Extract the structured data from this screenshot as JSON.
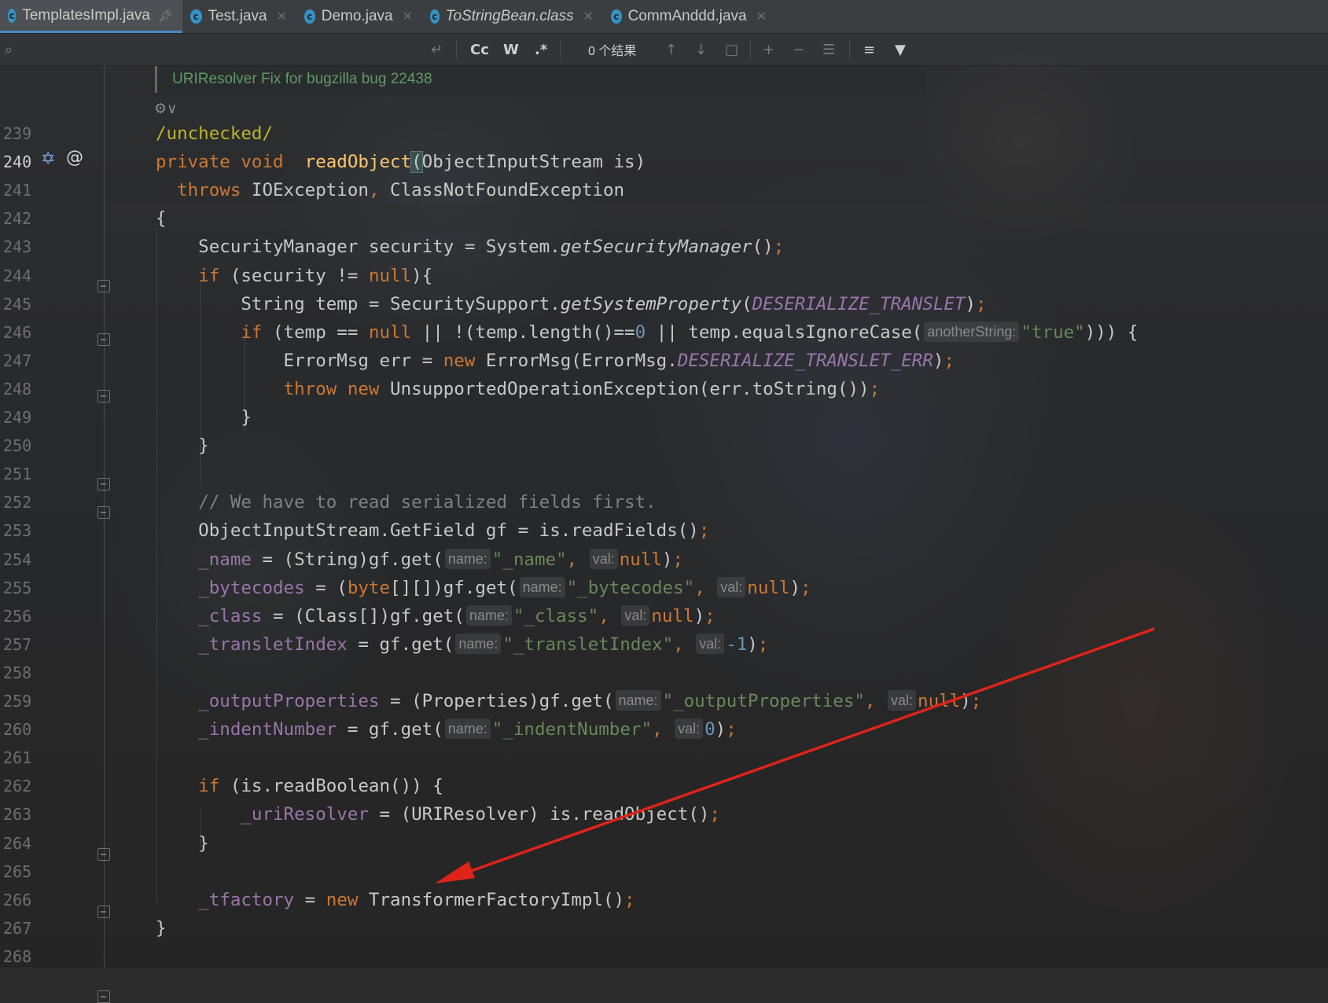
{
  "tabs": [
    {
      "label": "TemplatesImpl.java",
      "active": true,
      "pinned": true
    },
    {
      "label": "Test.java",
      "active": false
    },
    {
      "label": "Demo.java",
      "active": false
    },
    {
      "label": "ToStringBean.class",
      "active": false,
      "italic": true
    },
    {
      "label": "CommAnddd.java",
      "active": false
    }
  ],
  "find": {
    "search_icon": "search-icon",
    "result_count": "0 个结果",
    "match_case": "Cc",
    "words": "W",
    "regex": ".*"
  },
  "doc_comment": "URIResolver Fix for bugzilla bug 22438",
  "lines": [
    {
      "n": "239",
      "html": "<span class=\"ann\">/unchecked/</span>"
    },
    {
      "n": "240",
      "html": "<span class=\"kw\">private void</span>  <span class=\"fn\">readObject</span><span class=\"parenhl\">(</span>ObjectInputStream is)"
    },
    {
      "n": "241",
      "html": "  <span class=\"kw\">throws</span> IOException<span class=\"kw\">,</span> ClassNotFoundException"
    },
    {
      "n": "242",
      "html": "{"
    },
    {
      "n": "243",
      "html": "    SecurityManager security = System.<span class=\"it\">getSecurityManager</span>()<span class=\"kw\">;</span>"
    },
    {
      "n": "244",
      "html": "    <span class=\"kw\">if</span> (security != <span class=\"kw\">null</span>){"
    },
    {
      "n": "245",
      "html": "        String temp = SecuritySupport.<span class=\"it\">getSystemProperty</span>(<span class=\"sf\">DESERIALIZE_TRANSLET</span>)<span class=\"kw\">;</span>"
    },
    {
      "n": "246",
      "html": "        <span class=\"kw\">if</span> (temp == <span class=\"kw\">null</span> || !(temp.length()==<span class=\"num\">0</span> || temp.equalsIgnoreCase(<span class=\"hint\">anotherString:</span><span class=\"str\">\"true\"</span>))) {"
    },
    {
      "n": "247",
      "html": "            ErrorMsg err = <span class=\"kw\">new</span> ErrorMsg(ErrorMsg.<span class=\"sf\">DESERIALIZE_TRANSLET_ERR</span>)<span class=\"kw\">;</span>"
    },
    {
      "n": "248",
      "html": "            <span class=\"kw\">throw new</span> UnsupportedOperationException(err.toString())<span class=\"kw\">;</span>"
    },
    {
      "n": "249",
      "html": "        }"
    },
    {
      "n": "250",
      "html": "    }"
    },
    {
      "n": "251",
      "html": ""
    },
    {
      "n": "252",
      "html": "    <span class=\"cm\">// We have to read serialized fields first.</span>"
    },
    {
      "n": "253",
      "html": "    ObjectInputStream.GetField gf = is.readFields()<span class=\"kw\">;</span>"
    },
    {
      "n": "254",
      "html": "    <span class=\"fld\">_name</span> = (String)gf.get(<span class=\"hint\">name:</span><span class=\"str\">\"_name\"</span><span class=\"kw\">,</span> <span class=\"hint\">val:</span><span class=\"kw\">null</span>)<span class=\"kw\">;</span>"
    },
    {
      "n": "255",
      "html": "    <span class=\"fld\">_bytecodes</span> = (<span class=\"kw\">byte</span>[][])gf.get(<span class=\"hint\">name:</span><span class=\"str\">\"_bytecodes\"</span><span class=\"kw\">,</span> <span class=\"hint\">val:</span><span class=\"kw\">null</span>)<span class=\"kw\">;</span>"
    },
    {
      "n": "256",
      "html": "    <span class=\"fld\">_class</span> = (Class[])gf.get(<span class=\"hint\">name:</span><span class=\"str\">\"_class\"</span><span class=\"kw\">,</span> <span class=\"hint\">val:</span><span class=\"kw\">null</span>)<span class=\"kw\">;</span>"
    },
    {
      "n": "257",
      "html": "    <span class=\"fld\">_transletIndex</span> = gf.get(<span class=\"hint\">name:</span><span class=\"str\">\"_transletIndex\"</span><span class=\"kw\">,</span> <span class=\"hint\">val:</span><span class=\"num\">-1</span>)<span class=\"kw\">;</span>"
    },
    {
      "n": "258",
      "html": ""
    },
    {
      "n": "259",
      "html": "    <span class=\"fld\">_outputProperties</span> = (Properties)gf.get(<span class=\"hint\">name:</span><span class=\"str\">\"_outputProperties\"</span><span class=\"kw\">,</span> <span class=\"hint\">val:</span><span class=\"kw\">null</span>)<span class=\"kw\">;</span>"
    },
    {
      "n": "260",
      "html": "    <span class=\"fld\">_indentNumber</span> = gf.get(<span class=\"hint\">name:</span><span class=\"str\">\"_indentNumber\"</span><span class=\"kw\">,</span> <span class=\"hint\">val:</span><span class=\"num\">0</span>)<span class=\"kw\">;</span>"
    },
    {
      "n": "261",
      "html": ""
    },
    {
      "n": "262",
      "html": "    <span class=\"kw\">if</span> (is.readBoolean()) {"
    },
    {
      "n": "263",
      "html": "        <span class=\"fld\">_uriResolver</span> = (URIResolver) is.readObject()<span class=\"kw\">;</span>"
    },
    {
      "n": "264",
      "html": "    }"
    },
    {
      "n": "265",
      "html": ""
    },
    {
      "n": "266",
      "html": "    <span class=\"fld\">_tfactory</span> = <span class=\"kw\">new</span> TransformerFactoryImpl()<span class=\"kw\">;</span>"
    },
    {
      "n": "267",
      "html": "}"
    },
    {
      "n": "268",
      "html": ""
    }
  ],
  "gutter_icons": {
    "line_240": [
      "override-icon",
      "annotation-at-icon"
    ],
    "at_symbol": "@"
  },
  "colors": {
    "keyword": "#cc7832",
    "method": "#ffc66d",
    "static_field": "#9876aa",
    "string": "#6a8759",
    "number": "#6897bb",
    "comment": "#808080",
    "annotation": "#bbb529",
    "arrow": "#e0231a"
  }
}
